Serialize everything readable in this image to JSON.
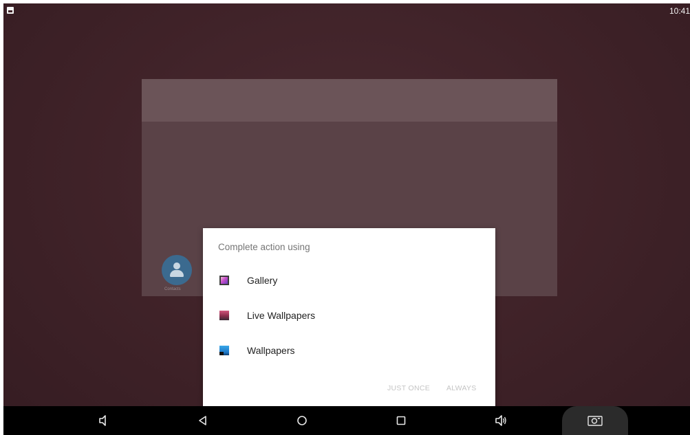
{
  "status_bar": {
    "time": "10:41",
    "notification_icon": "image-notification-icon"
  },
  "background_recent": {
    "contact_label": "Contacts"
  },
  "dialog": {
    "title": "Complete action using",
    "apps": [
      {
        "label": "Gallery",
        "icon": "gallery-icon"
      },
      {
        "label": "Live Wallpapers",
        "icon": "live-wallpapers-icon"
      },
      {
        "label": "Wallpapers",
        "icon": "wallpapers-icon"
      }
    ],
    "just_once": "JUST ONCE",
    "always": "ALWAYS"
  },
  "nav_bar": {
    "buttons": [
      "volume-down-icon",
      "back-icon",
      "home-icon",
      "recents-icon",
      "volume-up-icon",
      "screenshot-icon"
    ]
  }
}
